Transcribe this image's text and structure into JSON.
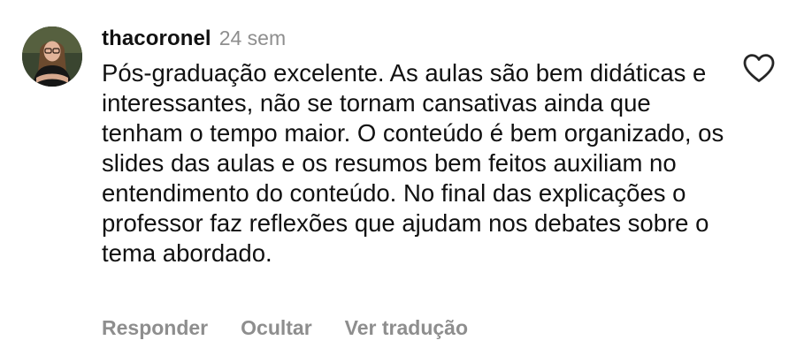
{
  "comment": {
    "username": "thacoronel",
    "time": "24 sem",
    "text": "Pós-graduação excelente. As aulas são bem didáticas e interessantes, não se tornam cansativas ainda que tenham o tempo maior. O conteúdo é bem organizado, os slides das aulas e os resumos bem feitos auxiliam no entendimento do conteúdo. No final das explicações o professor faz reflexões que ajudam nos debates sobre o tema abordado.",
    "actions": {
      "reply": "Responder",
      "hide": "Ocultar",
      "translate": "Ver tradução"
    },
    "like_icon": "heart-outline-icon"
  },
  "colors": {
    "text": "#111111",
    "secondary": "#8e8e8e"
  }
}
